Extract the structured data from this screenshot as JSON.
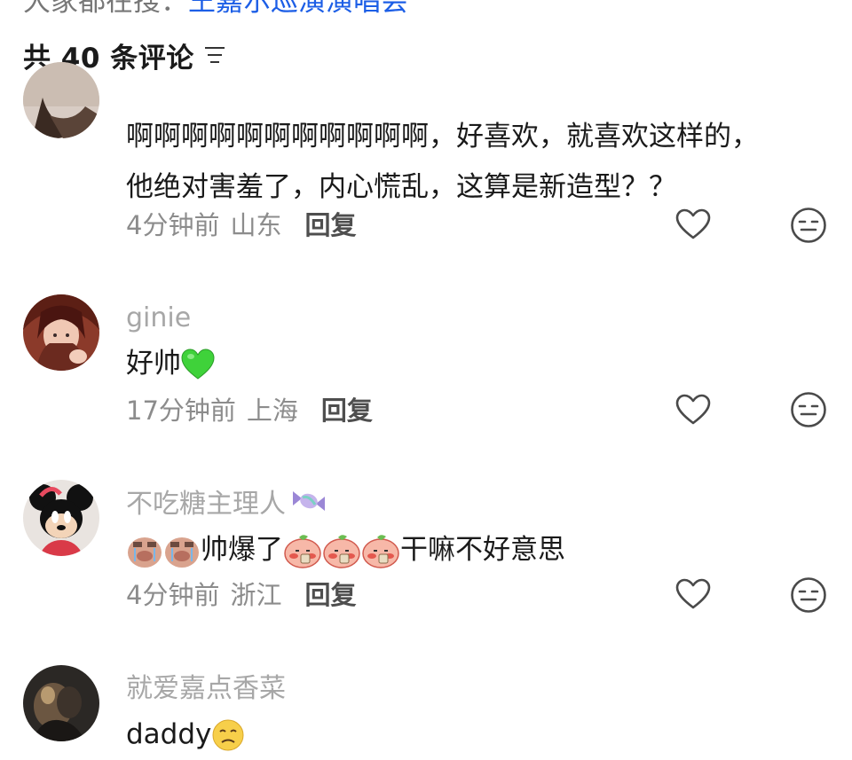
{
  "post": {
    "title_part1": "大家都在搜：",
    "title_part2": "王嘉尔巡演演唱会"
  },
  "comments_header": {
    "label": "共 40 条评论"
  },
  "comments": [
    {
      "username": "",
      "text_line1": "啊啊啊啊啊啊啊啊啊啊啊，好喜欢，就喜欢这样的，",
      "text_line2": "他绝对害羞了，内心慌乱，这算是新造型？？",
      "time": "4分钟前",
      "location": "山东",
      "reply_label": "回复"
    },
    {
      "username": "ginie",
      "text": "好帅",
      "text_emoji": "green-heart",
      "time": "17分钟前",
      "location": "上海",
      "reply_label": "回复"
    },
    {
      "username": "不吃糖主理人",
      "username_emoji": "candy",
      "text": "帅爆了",
      "text_suffix": "干嘛不好意思",
      "time": "4分钟前",
      "location": "浙江",
      "reply_label": "回复"
    },
    {
      "username": "就爱嘉点香菜",
      "text": "daddy",
      "text_emoji": "crying-face"
    }
  ],
  "icons": {
    "filter": "filter-icon",
    "like": "heart-outline-icon",
    "dislike": "neutral-face-icon"
  },
  "colors": {
    "link_blue": "#1c5ee6",
    "meta_gray": "#8c8c8c",
    "username_gray": "#a7a7a7",
    "text_dark": "#1a1a1a",
    "green_heart": "#3fd23a"
  }
}
